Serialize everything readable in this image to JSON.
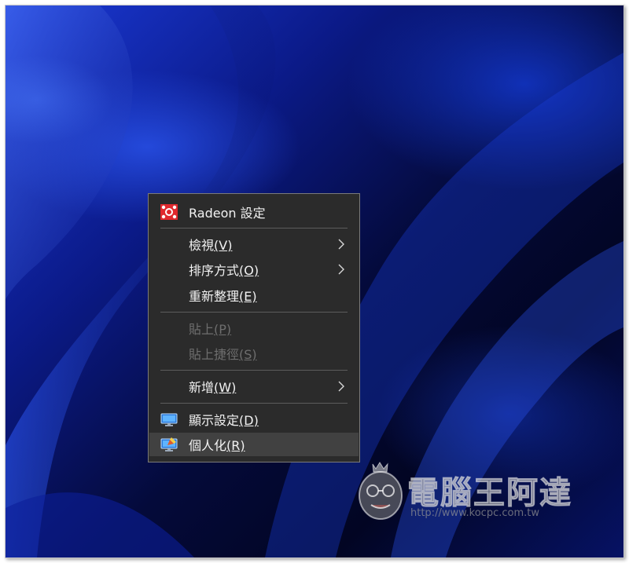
{
  "menu": {
    "radeon": "Radeon 設定",
    "view": {
      "text": "檢視",
      "key": "(V)"
    },
    "sort": {
      "text": "排序方式",
      "key": "(O)"
    },
    "refresh": {
      "text": "重新整理",
      "key": "(E)"
    },
    "paste": {
      "text": "貼上",
      "key": "(P)"
    },
    "paste_shortcut": {
      "text": "貼上捷徑",
      "key": "(S)"
    },
    "new": {
      "text": "新增",
      "key": "(W)"
    },
    "display": {
      "text": "顯示設定",
      "key": "(D)"
    },
    "personalize": {
      "text": "個人化",
      "key": "(R)"
    }
  },
  "watermark": {
    "title": "電腦王阿達",
    "url": "http://www.kocpc.com.tw"
  },
  "icons": {
    "radeon": "radeon-logo-icon",
    "display": "display-monitor-icon",
    "personalize": "personalize-monitor-icon",
    "submenu": "chevron-right-icon"
  },
  "colors": {
    "menu_bg": "#2b2b2b",
    "highlight": "#414141",
    "disabled_text": "#6e6e6e",
    "radeon_red": "#e0282d"
  }
}
